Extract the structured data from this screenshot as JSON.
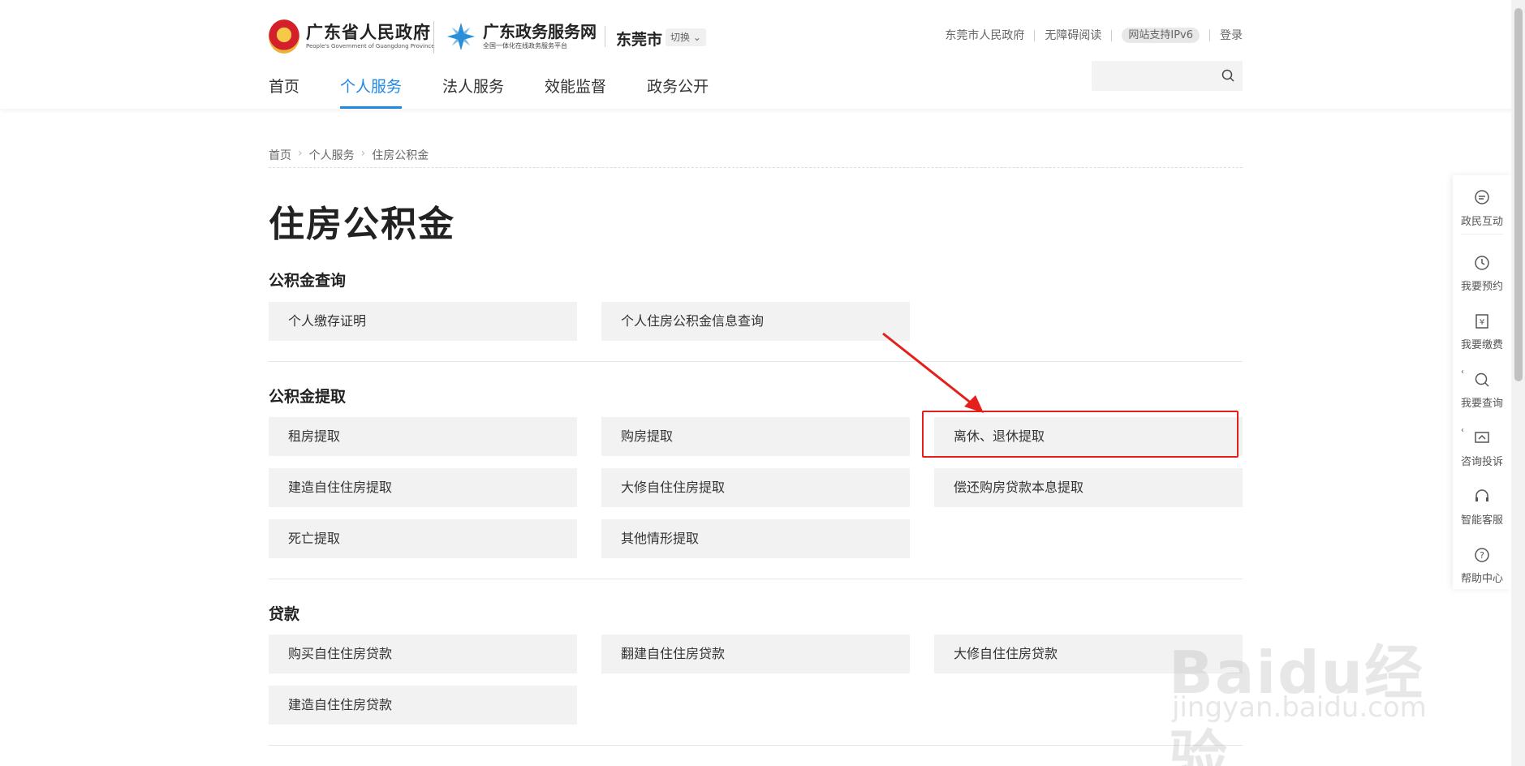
{
  "header": {
    "gov_name": "广东省人民政府",
    "gov_name_en": "People's Government of Guangdong Province",
    "service_name": "广东政务服务网",
    "service_sub": "全国一体化在线政务服务平台",
    "city": "东莞市",
    "switch_label": "切换",
    "top_links": [
      "东莞市人民政府",
      "无障碍阅读",
      "网站支持IPv6",
      "登录"
    ],
    "nav": [
      "首页",
      "个人服务",
      "法人服务",
      "效能监督",
      "政务公开"
    ],
    "active_nav": "个人服务",
    "search_placeholder": ""
  },
  "breadcrumb": [
    "首页",
    "个人服务",
    "住房公积金"
  ],
  "page_title": "住房公积金",
  "sections": [
    {
      "title": "公积金查询",
      "items": [
        "个人缴存证明",
        "个人住房公积金信息查询"
      ]
    },
    {
      "title": "公积金提取",
      "items": [
        "租房提取",
        "购房提取",
        "离休、退休提取",
        "建造自住住房提取",
        "大修自住住房提取",
        "偿还购房贷款本息提取",
        "死亡提取",
        "其他情形提取"
      ]
    },
    {
      "title": "贷款",
      "items": [
        "购买自住住房贷款",
        "翻建自住住房贷款",
        "大修自住住房贷款",
        "建造自住住房贷款"
      ]
    }
  ],
  "highlighted_item": "离休、退休提取",
  "float_bar": [
    "政民互动",
    "我要预约",
    "我要缴费",
    "我要查询",
    "咨询投诉",
    "智能客服",
    "帮助中心"
  ],
  "watermark": {
    "brand": "Baidu经验",
    "url": "jingyan.baidu.com"
  },
  "colors": {
    "accent": "#1e88e5",
    "highlight": "#e5201c",
    "card_bg": "#f2f2f2"
  }
}
